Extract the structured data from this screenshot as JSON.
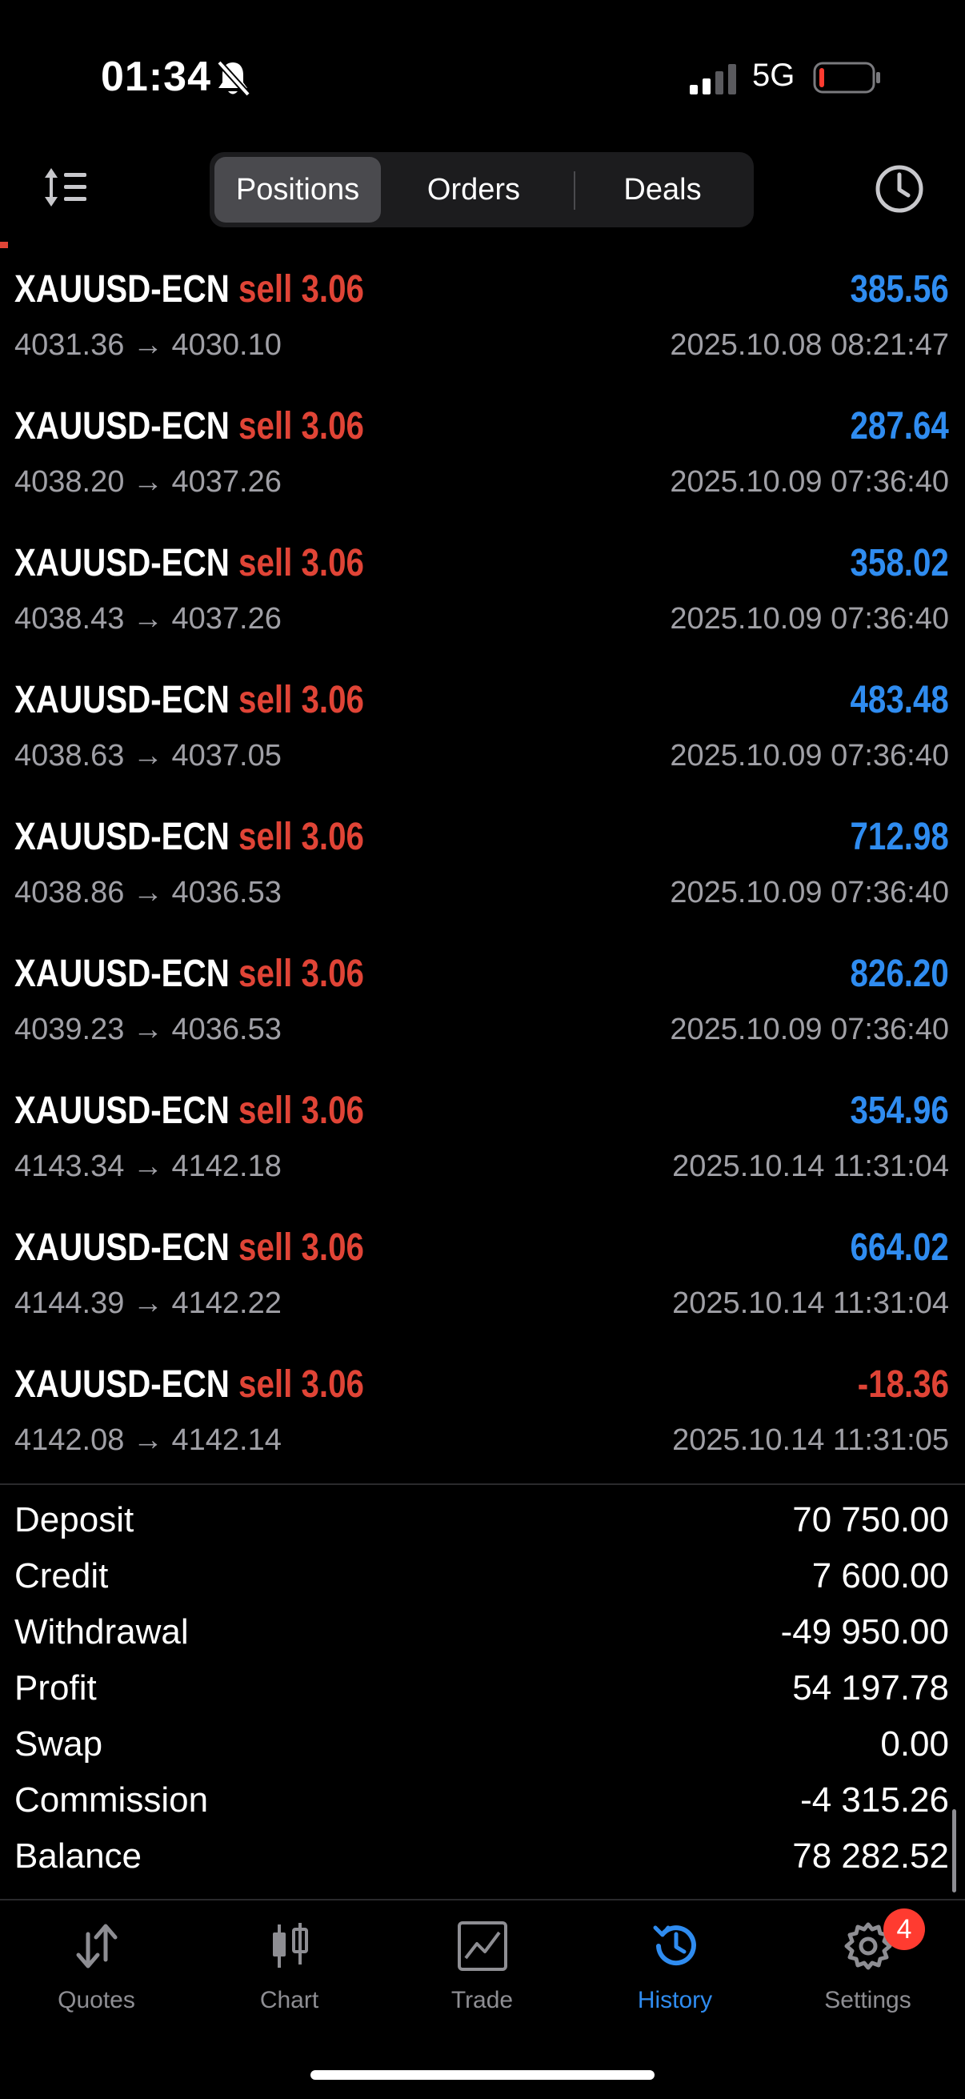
{
  "status_bar": {
    "time": "01:34",
    "network": "5G",
    "icons": [
      "bell-slash-icon",
      "cellular-signal-icon",
      "battery-low-icon"
    ]
  },
  "toolbar": {
    "sort_icon": "sort-icon",
    "history_icon": "clock-icon",
    "segments": [
      "Positions",
      "Orders",
      "Deals"
    ],
    "selected_segment": "Positions"
  },
  "colors": {
    "profit_positive": "#2f8cf0",
    "profit_negative": "#e04436",
    "sell": "#e04436",
    "accent": "#2f8cf0",
    "badge": "#ff3b30"
  },
  "deals": [
    {
      "symbol": "XAUUSD-ECN",
      "side": "sell",
      "volume": "3.06",
      "profit": "385.56",
      "open_price": "4031.36",
      "close_price": "4030.10",
      "time": "2025.10.08 08:21:47"
    },
    {
      "symbol": "XAUUSD-ECN",
      "side": "sell",
      "volume": "3.06",
      "profit": "287.64",
      "open_price": "4038.20",
      "close_price": "4037.26",
      "time": "2025.10.09 07:36:40"
    },
    {
      "symbol": "XAUUSD-ECN",
      "side": "sell",
      "volume": "3.06",
      "profit": "358.02",
      "open_price": "4038.43",
      "close_price": "4037.26",
      "time": "2025.10.09 07:36:40"
    },
    {
      "symbol": "XAUUSD-ECN",
      "side": "sell",
      "volume": "3.06",
      "profit": "483.48",
      "open_price": "4038.63",
      "close_price": "4037.05",
      "time": "2025.10.09 07:36:40"
    },
    {
      "symbol": "XAUUSD-ECN",
      "side": "sell",
      "volume": "3.06",
      "profit": "712.98",
      "open_price": "4038.86",
      "close_price": "4036.53",
      "time": "2025.10.09 07:36:40"
    },
    {
      "symbol": "XAUUSD-ECN",
      "side": "sell",
      "volume": "3.06",
      "profit": "826.20",
      "open_price": "4039.23",
      "close_price": "4036.53",
      "time": "2025.10.09 07:36:40"
    },
    {
      "symbol": "XAUUSD-ECN",
      "side": "sell",
      "volume": "3.06",
      "profit": "354.96",
      "open_price": "4143.34",
      "close_price": "4142.18",
      "time": "2025.10.14 11:31:04"
    },
    {
      "symbol": "XAUUSD-ECN",
      "side": "sell",
      "volume": "3.06",
      "profit": "664.02",
      "open_price": "4144.39",
      "close_price": "4142.22",
      "time": "2025.10.14 11:31:04"
    },
    {
      "symbol": "XAUUSD-ECN",
      "side": "sell",
      "volume": "3.06",
      "profit": "-18.36",
      "open_price": "4142.08",
      "close_price": "4142.14",
      "time": "2025.10.14 11:31:05"
    }
  ],
  "summary": [
    {
      "label": "Deposit",
      "value": "70 750.00"
    },
    {
      "label": "Credit",
      "value": "7 600.00"
    },
    {
      "label": "Withdrawal",
      "value": "-49 950.00"
    },
    {
      "label": "Profit",
      "value": "54 197.78"
    },
    {
      "label": "Swap",
      "value": "0.00"
    },
    {
      "label": "Commission",
      "value": "-4 315.26"
    },
    {
      "label": "Balance",
      "value": "78 282.52"
    }
  ],
  "tab_bar": {
    "tabs": [
      {
        "label": "Quotes",
        "icon": "arrows-up-down-icon"
      },
      {
        "label": "Chart",
        "icon": "candlestick-icon"
      },
      {
        "label": "Trade",
        "icon": "line-chart-icon"
      },
      {
        "label": "History",
        "icon": "history-icon"
      },
      {
        "label": "Settings",
        "icon": "gear-icon"
      }
    ],
    "active_tab": "History",
    "settings_badge": "4"
  }
}
